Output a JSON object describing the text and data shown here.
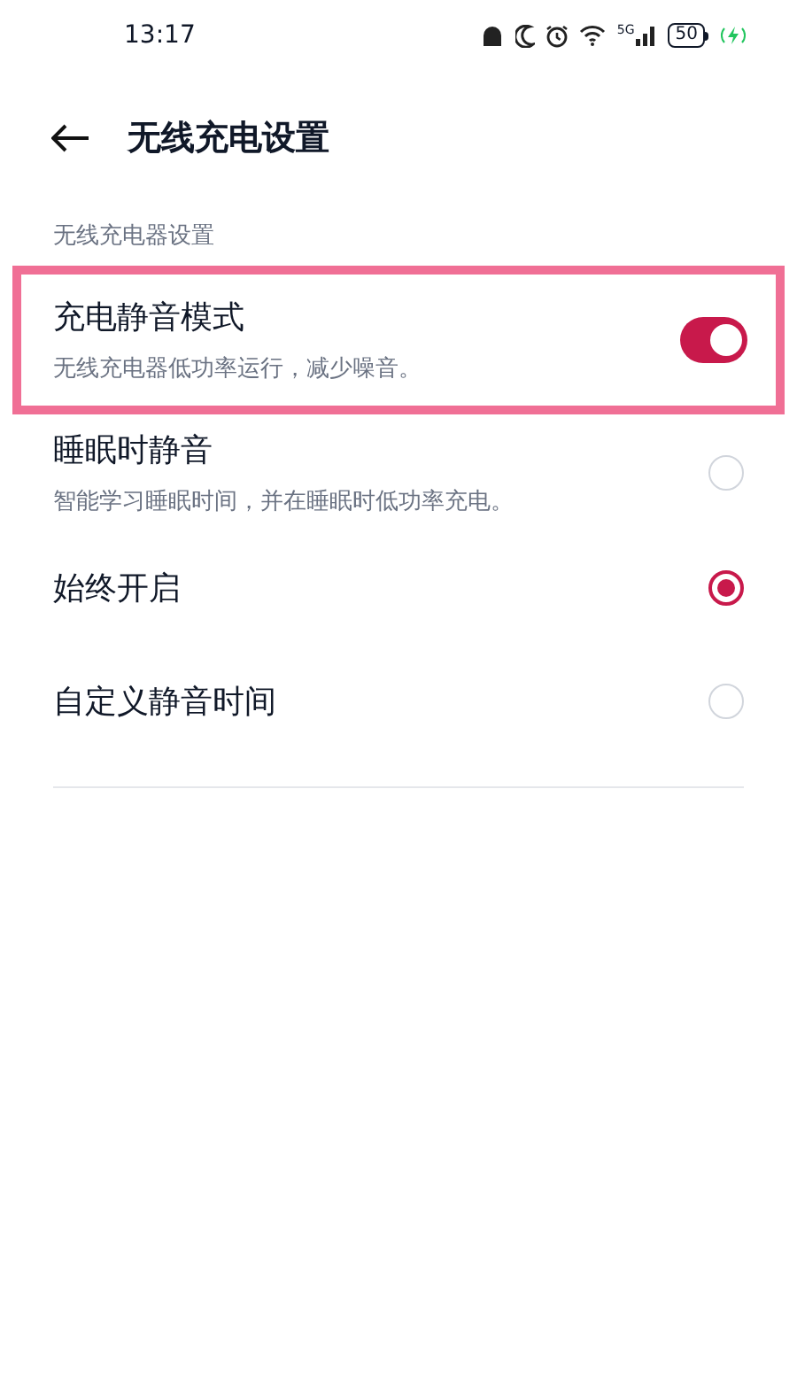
{
  "status_bar": {
    "time": "13:17",
    "network": "5G",
    "battery": "50",
    "charging": true
  },
  "header": {
    "title": "无线充电设置"
  },
  "section_label": "无线充电器设置",
  "mode_item": {
    "title": "充电静音模式",
    "subtitle": "无线充电器低功率运行，减少噪音。",
    "on": true,
    "highlighted": true
  },
  "options": [
    {
      "title": "睡眠时静音",
      "subtitle": "智能学习睡眠时间，并在睡眠时低功率充电。",
      "selected": false
    },
    {
      "title": "始终开启",
      "selected": true
    },
    {
      "title": "自定义静音时间",
      "selected": false
    }
  ]
}
